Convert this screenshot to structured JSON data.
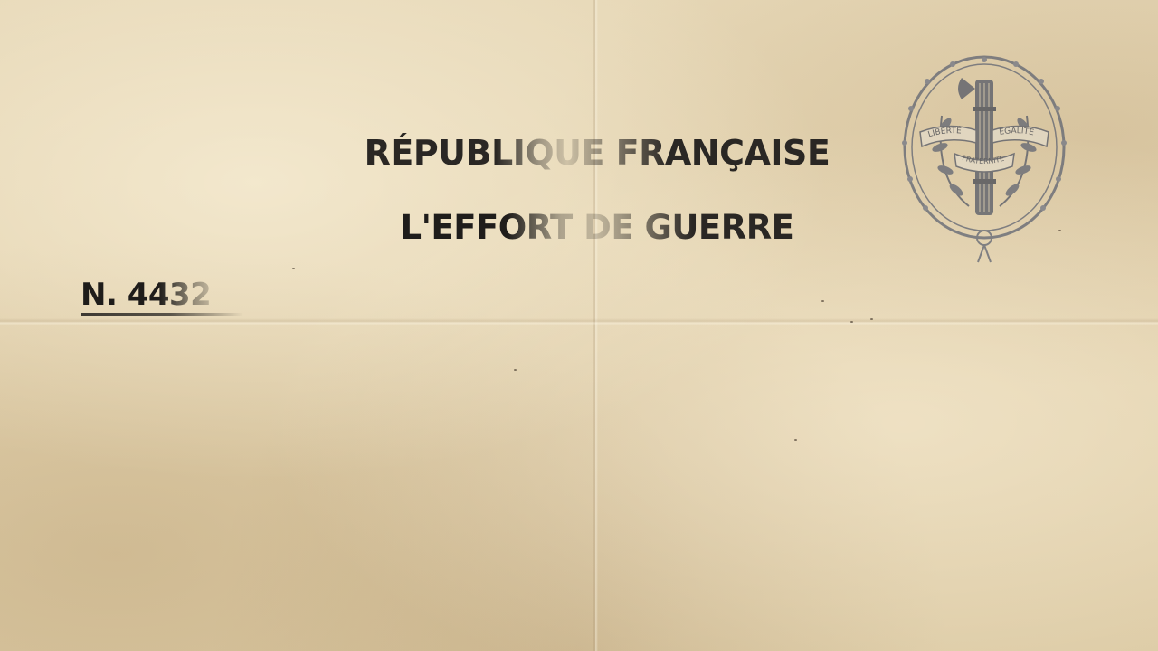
{
  "document": {
    "heading": "RÉPUBLIQUE FRANÇAISE",
    "subheading": "L'EFFORT DE GUERRE",
    "number": "N. 4432"
  },
  "seal": {
    "icon": "republic-seal-icon",
    "left_ribbon": "LIBERTÉ",
    "right_ribbon": "EGALITÉ",
    "bottom_ribbon": "FRATERNITÉ"
  },
  "colors": {
    "paper": "#e3d4b2",
    "ink": "#2a2724",
    "seal_ink": "#5a6070"
  }
}
